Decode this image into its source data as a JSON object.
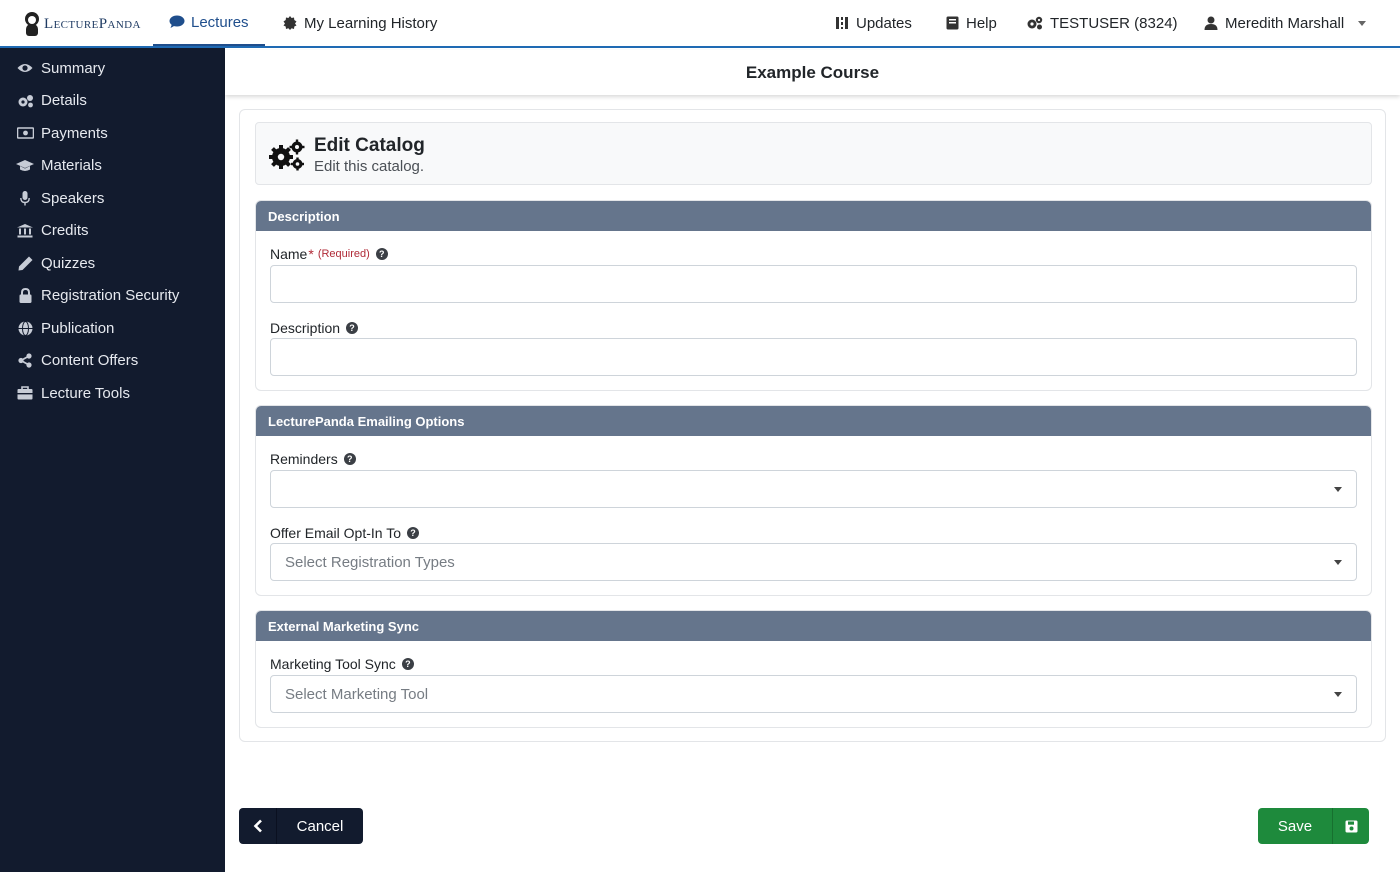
{
  "brand": {
    "logo_text": "LecturePanda"
  },
  "topnav": {
    "lectures": "Lectures",
    "history": "My Learning History",
    "updates": "Updates",
    "help": "Help",
    "org": "TESTUSER (8324)",
    "user": "Meredith Marshall"
  },
  "sidebar": {
    "items": [
      {
        "label": "Summary",
        "icon": "eye-icon"
      },
      {
        "label": "Details",
        "icon": "gears-icon"
      },
      {
        "label": "Payments",
        "icon": "money-bill-icon"
      },
      {
        "label": "Materials",
        "icon": "graduation-cap-icon"
      },
      {
        "label": "Speakers",
        "icon": "microphone-icon"
      },
      {
        "label": "Credits",
        "icon": "institution-icon"
      },
      {
        "label": "Quizzes",
        "icon": "pencil-icon"
      },
      {
        "label": "Registration Security",
        "icon": "lock-icon"
      },
      {
        "label": "Publication",
        "icon": "globe-icon"
      },
      {
        "label": "Content Offers",
        "icon": "share-icon"
      },
      {
        "label": "Lecture Tools",
        "icon": "toolbox-icon"
      }
    ]
  },
  "course": {
    "title": "Example Course"
  },
  "page": {
    "title": "Edit Catalog",
    "subtitle": "Edit this catalog."
  },
  "sections": {
    "description": {
      "header": "Description",
      "name_label": "Name",
      "required_star": "*",
      "required_text": "(Required)",
      "name_value": "",
      "description_label": "Description",
      "description_value": ""
    },
    "emailing": {
      "header": "LecturePanda Emailing Options",
      "reminders_label": "Reminders",
      "reminders_value": "",
      "optin_label": "Offer Email Opt-In To",
      "optin_placeholder": "Select Registration Types"
    },
    "marketing": {
      "header": "External Marketing Sync",
      "sync_label": "Marketing Tool Sync",
      "sync_placeholder": "Select Marketing Tool"
    }
  },
  "actions": {
    "cancel": "Cancel",
    "save": "Save"
  },
  "colors": {
    "sidebar": "#121b2e",
    "section_header": "#65758c",
    "save": "#1e8a3c",
    "nav_accent": "#1f4e8c"
  }
}
